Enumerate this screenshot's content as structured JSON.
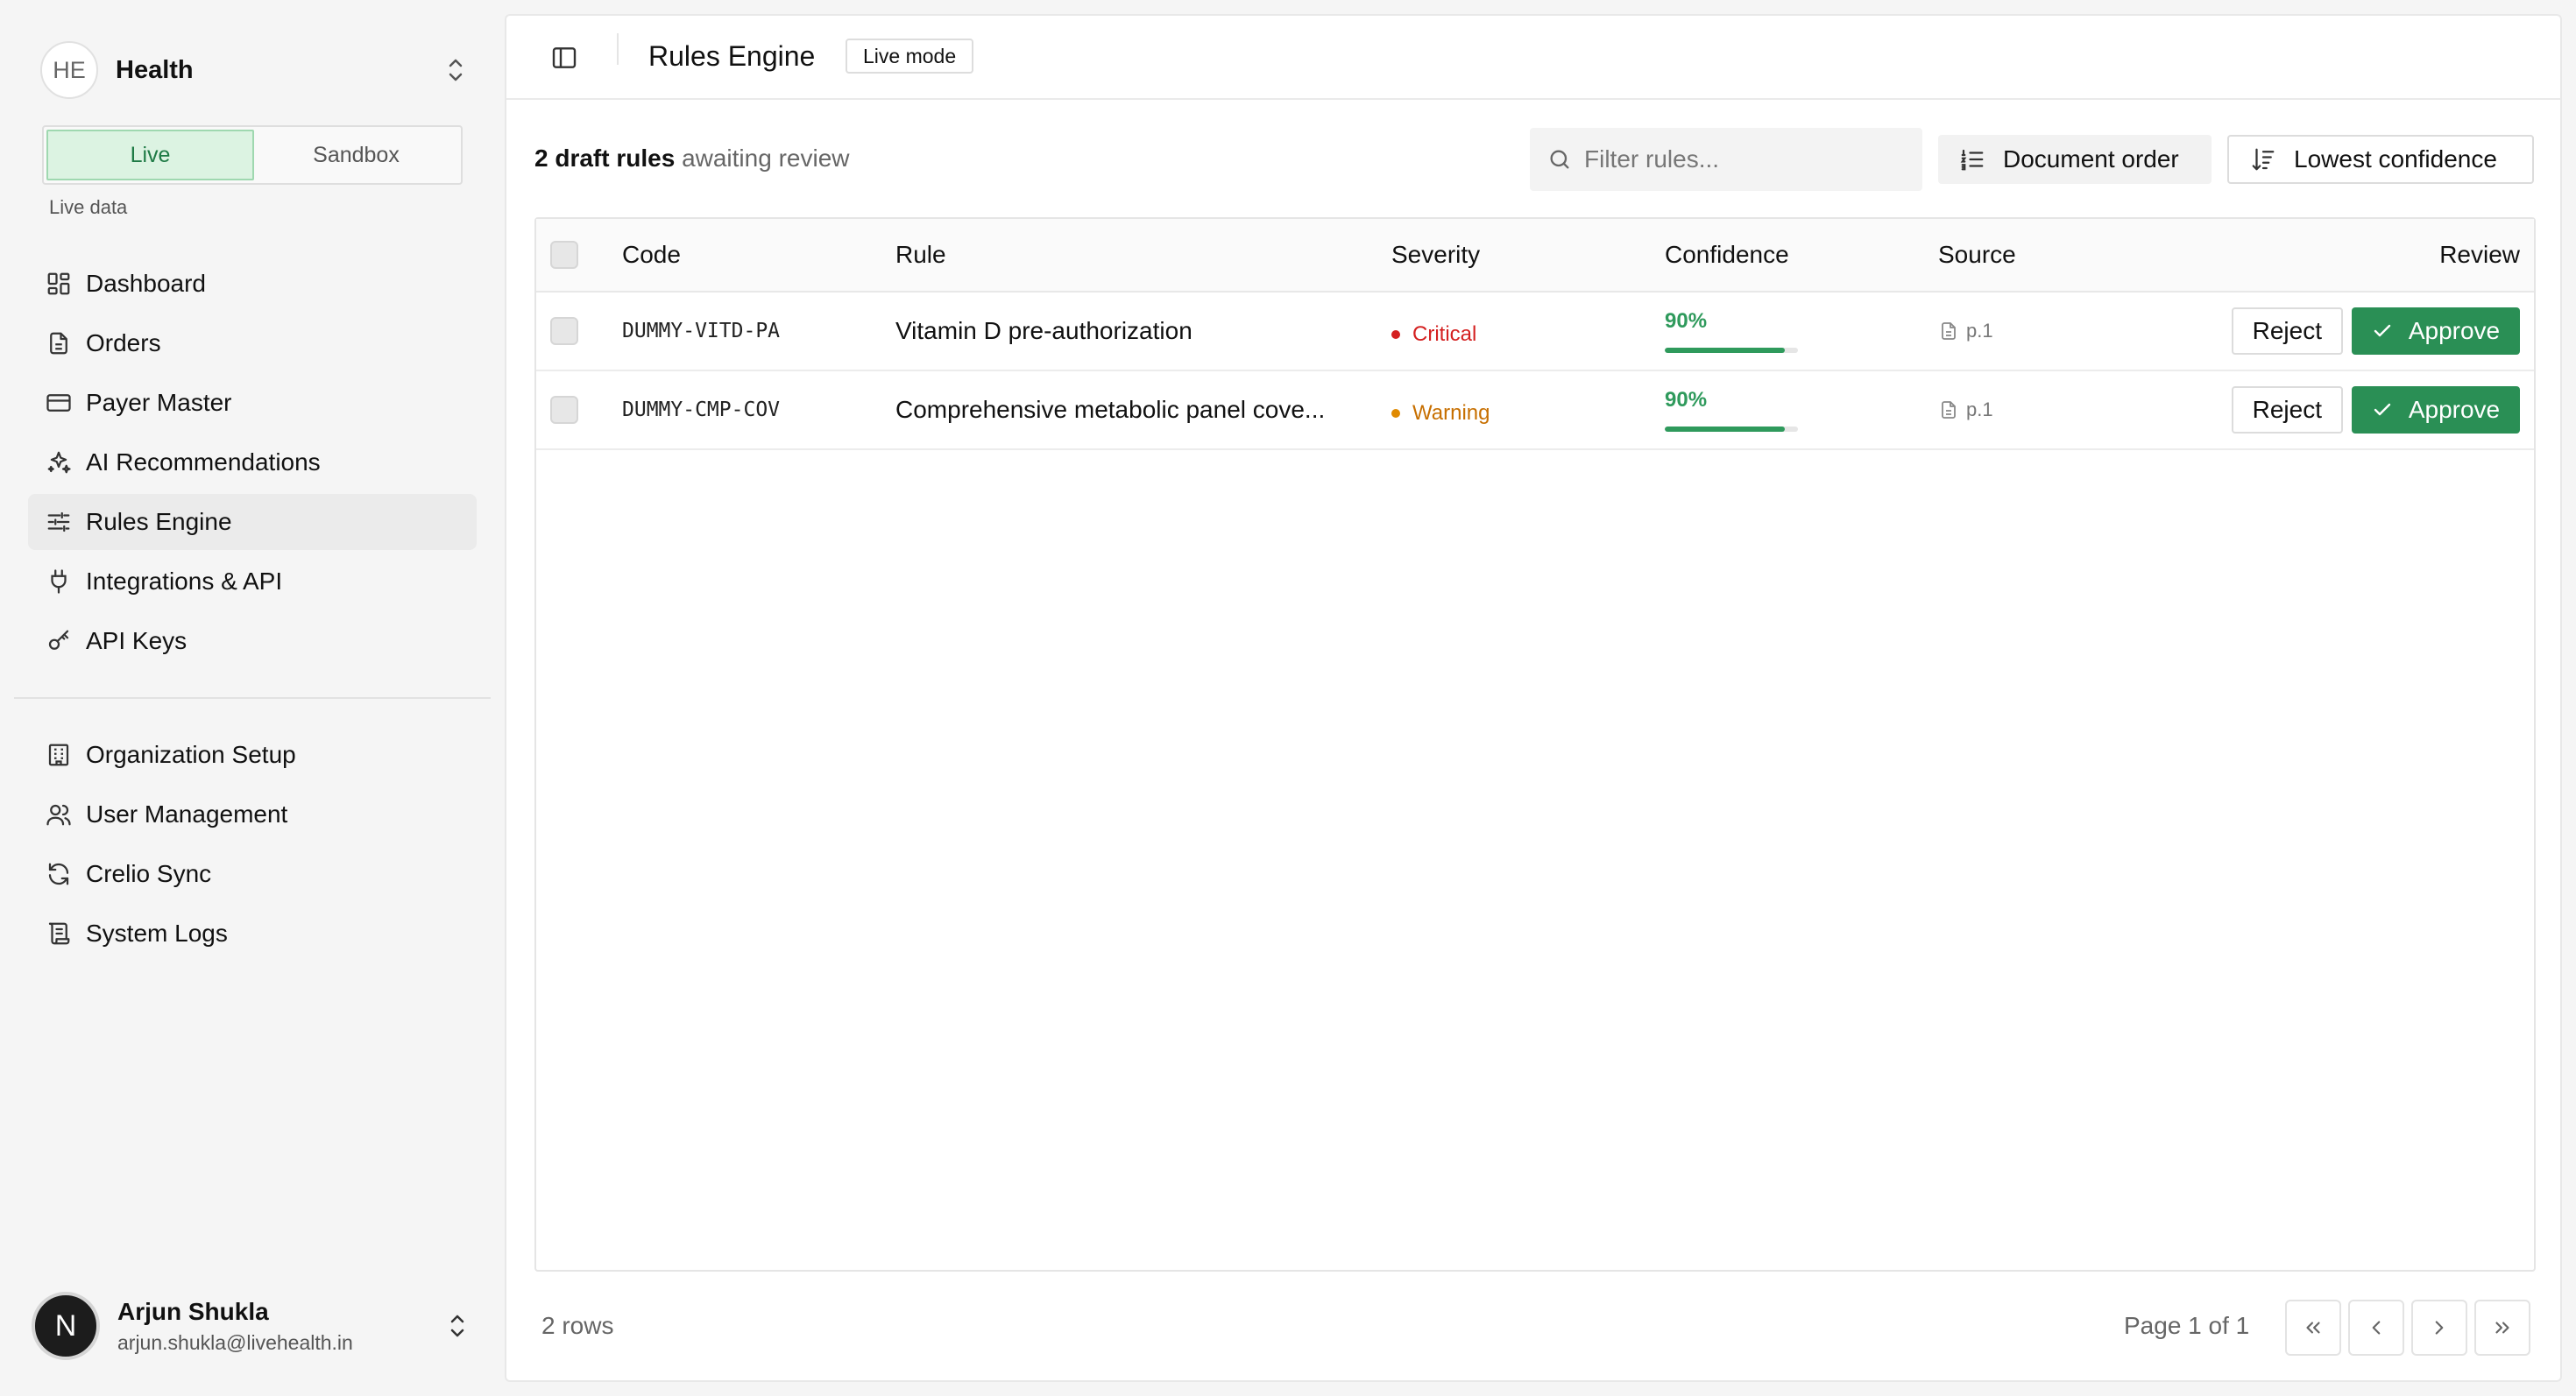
{
  "org": {
    "initials": "HE",
    "name": "Health"
  },
  "mode_toggle": {
    "live": "Live",
    "sandbox": "Sandbox",
    "caption": "Live data"
  },
  "nav_primary": [
    {
      "label": "Dashboard",
      "icon": "dashboard-icon"
    },
    {
      "label": "Orders",
      "icon": "orders-icon"
    },
    {
      "label": "Payer Master",
      "icon": "card-icon"
    },
    {
      "label": "AI Recommendations",
      "icon": "sparkles-icon"
    },
    {
      "label": "Rules Engine",
      "icon": "sliders-icon",
      "active": true
    },
    {
      "label": "Integrations & API",
      "icon": "plug-icon"
    },
    {
      "label": "API Keys",
      "icon": "key-icon"
    }
  ],
  "nav_secondary": [
    {
      "label": "Organization Setup",
      "icon": "building-icon"
    },
    {
      "label": "User Management",
      "icon": "users-icon"
    },
    {
      "label": "Crelio Sync",
      "icon": "sync-icon"
    },
    {
      "label": "System Logs",
      "icon": "scroll-icon"
    }
  ],
  "user": {
    "initial": "N",
    "name": "Arjun Shukla",
    "email": "arjun.shukla@livehealth.in"
  },
  "topbar": {
    "title": "Rules Engine",
    "badge": "Live mode"
  },
  "summary": {
    "count": "2 draft rules",
    "suffix": "awaiting review"
  },
  "filter": {
    "placeholder": "Filter rules..."
  },
  "sort": {
    "document_order": "Document order",
    "lowest_confidence": "Lowest confidence"
  },
  "table": {
    "columns": {
      "code": "Code",
      "rule": "Rule",
      "severity": "Severity",
      "confidence": "Confidence",
      "source": "Source",
      "review": "Review"
    },
    "rows": [
      {
        "code": "DUMMY-VITD-PA",
        "rule": "Vitamin D pre-authorization",
        "severity": "Critical",
        "confidence": "90%",
        "confidence_value": 0.9,
        "source": "p.1",
        "reject": "Reject",
        "approve": "Approve"
      },
      {
        "code": "DUMMY-CMP-COV",
        "rule": "Comprehensive metabolic panel cove...",
        "severity": "Warning",
        "confidence": "90%",
        "confidence_value": 0.9,
        "source": "p.1",
        "reject": "Reject",
        "approve": "Approve"
      }
    ]
  },
  "footer": {
    "rows": "2 rows",
    "page_info": "Page 1 of 1"
  },
  "colors": {
    "accent_green": "#2a8f55",
    "critical": "#d42020",
    "warning": "#e08a00",
    "warning_text": "#c76f00"
  }
}
